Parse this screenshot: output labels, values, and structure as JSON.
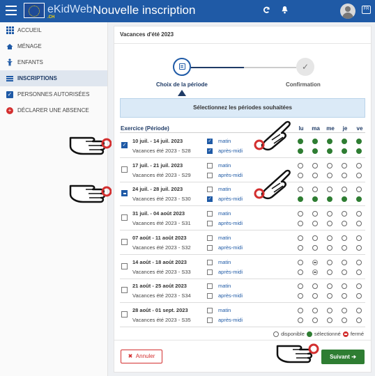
{
  "app": {
    "brand": "eKidWeb",
    "brand_sub": ".CH",
    "title": "Nouvelle inscription"
  },
  "sidebar": {
    "items": [
      {
        "label": "ACCUEIL",
        "icon": "home-grid-icon",
        "active": false
      },
      {
        "label": "MÉNAGE",
        "icon": "house-icon",
        "active": false
      },
      {
        "label": "ENFANTS",
        "icon": "child-icon",
        "active": false
      },
      {
        "label": "INSCRIPTIONS",
        "icon": "list-icon",
        "active": true
      },
      {
        "label": "PERSONNES AUTORISÉES",
        "icon": "checkbox-icon",
        "active": false
      },
      {
        "label": "DÉCLARER UNE ABSENCE",
        "icon": "plus-circle-icon",
        "active": false
      }
    ]
  },
  "card": {
    "title": "Vacances d'été 2023",
    "steps": [
      {
        "label": "Choix de la période",
        "icon": "calendar-icon",
        "active": true
      },
      {
        "label": "Confirmation",
        "icon": "check-icon",
        "active": false
      }
    ],
    "info": "Sélectionnez les périodes souhaitées",
    "table": {
      "header": "Exercice (Période)",
      "days": [
        "lu",
        "ma",
        "me",
        "je",
        "ve"
      ],
      "rows": [
        {
          "dates": "10 juil. - 14 juil. 2023",
          "period": "Vacances été 2023 - S28",
          "state": "checked",
          "matin": "matin",
          "apres_midi": "après-midi",
          "matin_checked": true,
          "apres_midi_checked": true,
          "matin_days": [
            "sel",
            "sel",
            "sel",
            "sel",
            "sel"
          ],
          "apres_midi_days": [
            "sel",
            "sel",
            "sel",
            "sel",
            "sel"
          ]
        },
        {
          "dates": "17 juil. - 21 juil. 2023",
          "period": "Vacances été 2023 - S29",
          "state": "unchecked",
          "matin": "matin",
          "apres_midi": "après-midi",
          "matin_checked": false,
          "apres_midi_checked": false,
          "matin_days": [
            "free",
            "free",
            "free",
            "free",
            "free"
          ],
          "apres_midi_days": [
            "free",
            "free",
            "free",
            "free",
            "free"
          ]
        },
        {
          "dates": "24 juil. - 28 juil. 2023",
          "period": "Vacances été 2023 - S30",
          "state": "indeterminate",
          "matin": "matin",
          "apres_midi": "après-midi",
          "matin_checked": false,
          "apres_midi_checked": true,
          "matin_days": [
            "free",
            "free",
            "free",
            "free",
            "free"
          ],
          "apres_midi_days": [
            "sel",
            "sel",
            "sel",
            "sel",
            "sel"
          ]
        },
        {
          "dates": "31 juil. - 04 août 2023",
          "period": "Vacances été 2023 - S31",
          "state": "unchecked",
          "matin": "matin",
          "apres_midi": "après-midi",
          "matin_checked": false,
          "apres_midi_checked": false,
          "matin_days": [
            "free",
            "free",
            "free",
            "free",
            "free"
          ],
          "apres_midi_days": [
            "free",
            "free",
            "free",
            "free",
            "free"
          ]
        },
        {
          "dates": "07 août - 11 août 2023",
          "period": "Vacances été 2023 - S32",
          "state": "unchecked",
          "matin": "matin",
          "apres_midi": "après-midi",
          "matin_checked": false,
          "apres_midi_checked": false,
          "matin_days": [
            "free",
            "free",
            "free",
            "free",
            "free"
          ],
          "apres_midi_days": [
            "free",
            "free",
            "free",
            "free",
            "free"
          ]
        },
        {
          "dates": "14 août - 18 août 2023",
          "period": "Vacances été 2023 - S33",
          "state": "unchecked",
          "matin": "matin",
          "apres_midi": "après-midi",
          "matin_checked": false,
          "apres_midi_checked": false,
          "matin_days": [
            "free",
            "closed",
            "free",
            "free",
            "free"
          ],
          "apres_midi_days": [
            "free",
            "closed",
            "free",
            "free",
            "free"
          ]
        },
        {
          "dates": "21 août - 25 août 2023",
          "period": "Vacances été 2023 - S34",
          "state": "unchecked",
          "matin": "matin",
          "apres_midi": "après-midi",
          "matin_checked": false,
          "apres_midi_checked": false,
          "matin_days": [
            "free",
            "free",
            "free",
            "free",
            "free"
          ],
          "apres_midi_days": [
            "free",
            "free",
            "free",
            "free",
            "free"
          ]
        },
        {
          "dates": "28 août - 01 sept. 2023",
          "period": "Vacances été 2023 - S35",
          "state": "unchecked",
          "matin": "matin",
          "apres_midi": "après-midi",
          "matin_checked": false,
          "apres_midi_checked": false,
          "matin_days": [
            "free",
            "free",
            "free",
            "free",
            "free"
          ],
          "apres_midi_days": [
            "free",
            "free",
            "free",
            "free",
            "free"
          ]
        }
      ]
    },
    "legend": {
      "available": "disponible",
      "selected": "sélectionné",
      "closed": "fermé"
    },
    "buttons": {
      "cancel": "Annuler",
      "next": "Suivant"
    }
  },
  "colors": {
    "topbar": "#1f5aa6",
    "selected": "#2e7d32",
    "closed": "#d32f2f"
  }
}
